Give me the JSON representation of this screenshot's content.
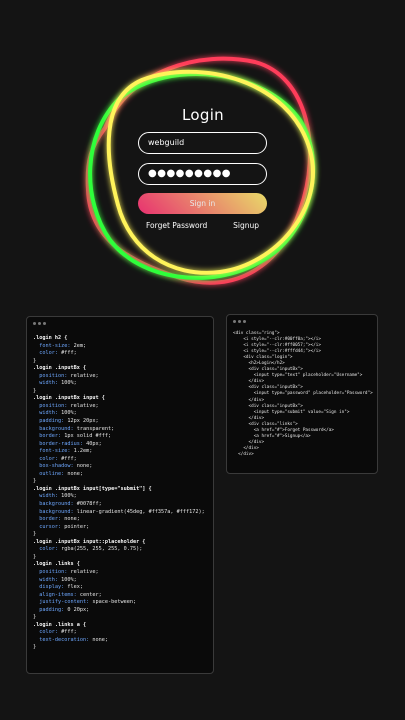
{
  "login": {
    "title": "Login",
    "username_value": "webguild",
    "username_placeholder": "Username",
    "password_mask": "●●●●●●●●●",
    "password_placeholder": "Password",
    "signin_label": "Sign in",
    "forget_label": "Forget Password",
    "signup_label": "Signup"
  },
  "rings": {
    "colors": [
      "#ff3d5a",
      "#2dff3a",
      "#fff35a"
    ]
  },
  "css_panel": {
    "lines": [
      ".login h2 {",
      "  font-size: 2em;",
      "  color: #fff;",
      "}",
      ".login .inputBx {",
      "  position: relative;",
      "  width: 100%;",
      "}",
      ".login .inputBx input {",
      "  position: relative;",
      "  width: 100%;",
      "  padding: 12px 20px;",
      "  background: transparent;",
      "  border: 1px solid #fff;",
      "  border-radius: 40px;",
      "  font-size: 1.2em;",
      "  color: #fff;",
      "  box-shadow: none;",
      "  outline: none;",
      "}",
      ".login .inputBx input[type=\"submit\"] {",
      "  width: 100%;",
      "  background: #0078ff;",
      "  background: linear-gradient(45deg, #ff357a, #fff172);",
      "  border: none;",
      "  cursor: pointer;",
      "}",
      ".login .inputBx input::placeholder {",
      "  color: rgba(255, 255, 255, 0.75);",
      "}",
      ".login .links {",
      "  position: relative;",
      "  width: 100%;",
      "  display: flex;",
      "  align-items: center;",
      "  justify-content: space-between;",
      "  padding: 0 20px;",
      "}",
      ".login .links a {",
      "  color: #fff;",
      "  text-decoration: none;",
      "}"
    ]
  },
  "html_panel": {
    "lines": [
      "<div class=\"ring\">",
      "    <i style=\"--clr:#00ff0a;\"></i>",
      "    <i style=\"--clr:#ff0057;\"></i>",
      "    <i style=\"--clr:#fffd44;\"></i>",
      "    <div class=\"login\">",
      "      <h2>Login</h2>",
      "      <div class=\"inputBx\">",
      "        <input type=\"text\" placeholder=\"Username\">",
      "      </div>",
      "      <div class=\"inputBx\">",
      "        <input type=\"password\" placeholder=\"Password\">",
      "      </div>",
      "      <div class=\"inputBx\">",
      "        <input type=\"submit\" value=\"Sign in\">",
      "      </div>",
      "      <div class=\"links\">",
      "        <a href=\"#\">Forget Password</a>",
      "        <a href=\"#\">Signup</a>",
      "      </div>",
      "    </div>",
      "  </div>"
    ]
  }
}
